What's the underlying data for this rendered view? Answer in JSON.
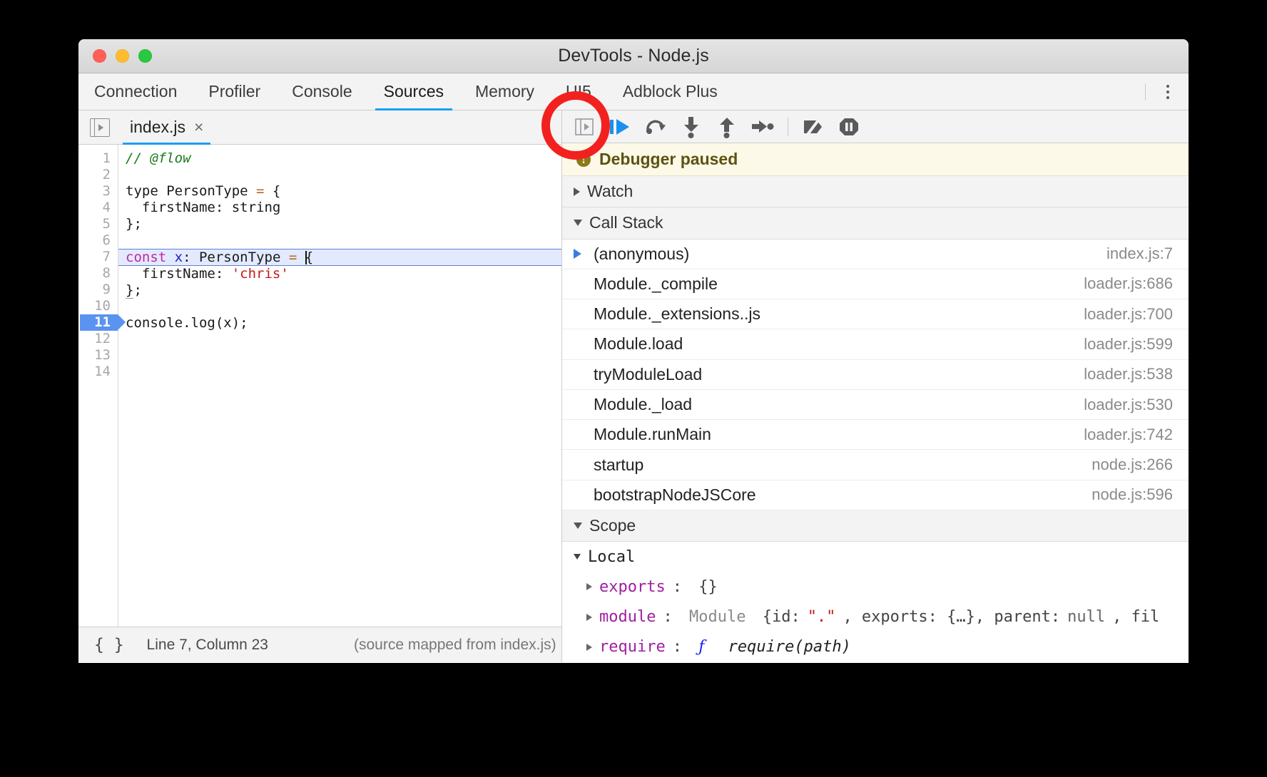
{
  "window": {
    "title": "DevTools - Node.js",
    "traffic_lights": [
      "close",
      "minimize",
      "maximize"
    ]
  },
  "tabs": [
    {
      "label": "Connection",
      "active": false
    },
    {
      "label": "Profiler",
      "active": false
    },
    {
      "label": "Console",
      "active": false
    },
    {
      "label": "Sources",
      "active": true
    },
    {
      "label": "Memory",
      "active": false
    },
    {
      "label": "UI5",
      "active": false
    },
    {
      "label": "Adblock Plus",
      "active": false
    }
  ],
  "tabbar_right": {
    "more_options_icon": "kebab-menu-icon"
  },
  "sources": {
    "navigator_toggle_icon": "show-navigator-icon",
    "file_tab": {
      "name": "index.js",
      "close_icon": "×"
    },
    "line_numbers": [
      "1",
      "2",
      "3",
      "4",
      "5",
      "6",
      "7",
      "8",
      "9",
      "10",
      "11",
      "12",
      "13",
      "14"
    ],
    "breakpoint_line": "11",
    "execution_line": "7",
    "code_lines": [
      {
        "n": "1",
        "text": "// @flow"
      },
      {
        "n": "2",
        "text": ""
      },
      {
        "n": "3",
        "text": "type PersonType = {"
      },
      {
        "n": "4",
        "text": "  firstName: string"
      },
      {
        "n": "5",
        "text": "};"
      },
      {
        "n": "6",
        "text": ""
      },
      {
        "n": "7",
        "text": "const x: PersonType = {"
      },
      {
        "n": "8",
        "text": "  firstName: 'chris'"
      },
      {
        "n": "9",
        "text": "};"
      },
      {
        "n": "10",
        "text": ""
      },
      {
        "n": "11",
        "text": "console.log(x);"
      },
      {
        "n": "12",
        "text": ""
      },
      {
        "n": "13",
        "text": ""
      },
      {
        "n": "14",
        "text": ""
      }
    ],
    "status_bar": {
      "pretty_print_icon": "{ }",
      "position": "Line 7, Column 23",
      "source_map": "(source mapped from index.js)"
    }
  },
  "debugger_toolbar": {
    "buttons": [
      {
        "name": "show-debugger-sidebar-icon",
        "title": ""
      },
      {
        "name": "resume-script-icon",
        "title": ""
      },
      {
        "name": "step-over-icon",
        "title": ""
      },
      {
        "name": "step-into-icon",
        "title": ""
      },
      {
        "name": "step-out-icon",
        "title": ""
      },
      {
        "name": "step-icon",
        "title": ""
      },
      {
        "name": "deactivate-breakpoints-icon",
        "title": ""
      },
      {
        "name": "pause-on-exceptions-icon",
        "title": ""
      }
    ],
    "highlighted_button": "resume-script-icon"
  },
  "debugger": {
    "banner": {
      "text": "Debugger paused",
      "icon": "info-icon"
    },
    "watch": {
      "label": "Watch",
      "expanded": false
    },
    "call_stack": {
      "label": "Call Stack",
      "expanded": true,
      "frames": [
        {
          "name": "(anonymous)",
          "location": "index.js:7",
          "selected": true
        },
        {
          "name": "Module._compile",
          "location": "loader.js:686",
          "selected": false
        },
        {
          "name": "Module._extensions..js",
          "location": "loader.js:700",
          "selected": false
        },
        {
          "name": "Module.load",
          "location": "loader.js:599",
          "selected": false
        },
        {
          "name": "tryModuleLoad",
          "location": "loader.js:538",
          "selected": false
        },
        {
          "name": "Module._load",
          "location": "loader.js:530",
          "selected": false
        },
        {
          "name": "Module.runMain",
          "location": "loader.js:742",
          "selected": false
        },
        {
          "name": "startup",
          "location": "node.js:266",
          "selected": false
        },
        {
          "name": "bootstrapNodeJSCore",
          "location": "node.js:596",
          "selected": false
        }
      ]
    },
    "scope": {
      "label": "Scope",
      "expanded": true,
      "groups": [
        {
          "name": "Local",
          "expanded": true,
          "entries": [
            {
              "prop": "exports",
              "value": "{}"
            },
            {
              "prop": "module",
              "value": "Module {id: \".\", exports: {…}, parent: null, fil"
            },
            {
              "prop": "require",
              "value": "ƒ require(path)"
            }
          ]
        }
      ]
    }
  },
  "annotation": {
    "shape": "circle",
    "color": "#f32020",
    "targets": "resume-script-icon"
  }
}
